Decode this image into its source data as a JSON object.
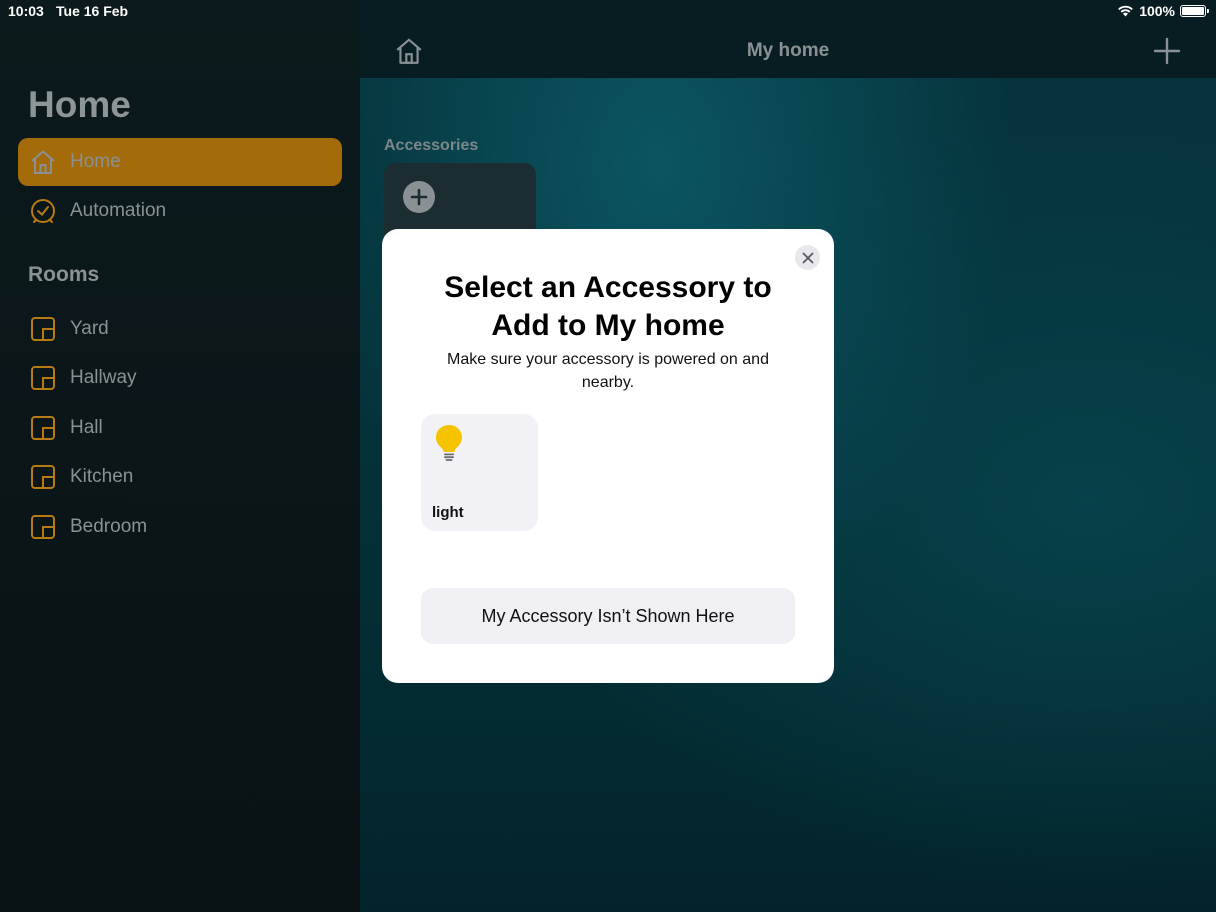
{
  "status_bar": {
    "time": "10:03",
    "date": "Tue 16 Feb",
    "battery": "100%"
  },
  "sidebar": {
    "title": "Home",
    "nav": [
      {
        "label": "Home",
        "icon": "house-icon",
        "selected": true
      },
      {
        "label": "Automation",
        "icon": "clock-icon",
        "selected": false
      }
    ],
    "rooms_heading": "Rooms",
    "rooms": [
      {
        "label": "Yard",
        "icon": "room-icon"
      },
      {
        "label": "Hallway",
        "icon": "room-icon"
      },
      {
        "label": "Hall",
        "icon": "room-icon"
      },
      {
        "label": "Kitchen",
        "icon": "room-icon"
      },
      {
        "label": "Bedroom",
        "icon": "room-icon"
      }
    ]
  },
  "main": {
    "title": "My home",
    "accessories_heading": "Accessories"
  },
  "modal": {
    "title": "Select an Accessory to Add to My home",
    "subtitle": "Make sure your accessory is powered on and nearby.",
    "accessories": [
      {
        "name": "light",
        "icon": "lightbulb-icon"
      }
    ],
    "not_shown_button": "My Accessory Isn’t Shown Here"
  },
  "colors": {
    "accent": "#a36b0a",
    "bulb": "#f5c300",
    "room_icon": "#b87a12"
  }
}
